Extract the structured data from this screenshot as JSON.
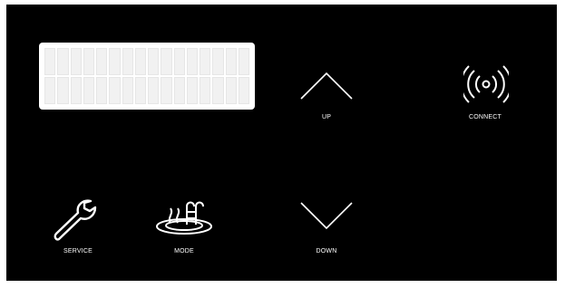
{
  "display": {
    "rows": 2,
    "cols": 16
  },
  "controls": {
    "up": {
      "label": "UP",
      "icon": "chevron-up-icon"
    },
    "down": {
      "label": "DOWN",
      "icon": "chevron-down-icon"
    },
    "connect": {
      "label": "CONNECT",
      "icon": "wireless-signal-icon"
    },
    "service": {
      "label": "SERVICE",
      "icon": "wrench-icon"
    },
    "mode": {
      "label": "MODE",
      "icon": "hot-tub-icon"
    }
  },
  "colors": {
    "panel": "#000000",
    "icon": "#ffffff",
    "display": "#ffffff"
  }
}
